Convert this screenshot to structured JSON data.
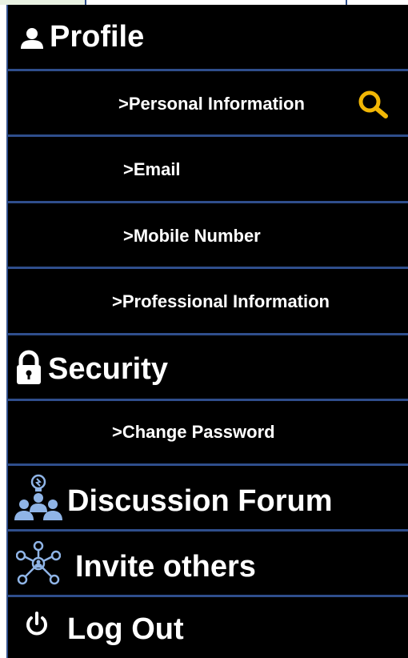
{
  "menu": {
    "profile": {
      "label": "Profile",
      "icon": "user-icon",
      "items": [
        {
          "label": ">Personal Information",
          "trailing_icon": "search-icon"
        },
        {
          "label": ">Email"
        },
        {
          "label": ">Mobile Number"
        },
        {
          "label": ">Professional Information"
        }
      ]
    },
    "security": {
      "label": "Security",
      "icon": "lock-icon",
      "items": [
        {
          "label": ">Change Password"
        }
      ]
    },
    "discussion_forum": {
      "label": "Discussion Forum",
      "icon": "group-idea-icon"
    },
    "invite_others": {
      "label": "Invite others",
      "icon": "network-icon"
    },
    "log_out": {
      "label": "Log Out",
      "icon": "power-icon"
    }
  },
  "colors": {
    "background": "#000000",
    "text": "#ffffff",
    "divider": "#2f4e8c",
    "search_icon": "#f2b705",
    "forum_icon": "#8fb4e6"
  }
}
